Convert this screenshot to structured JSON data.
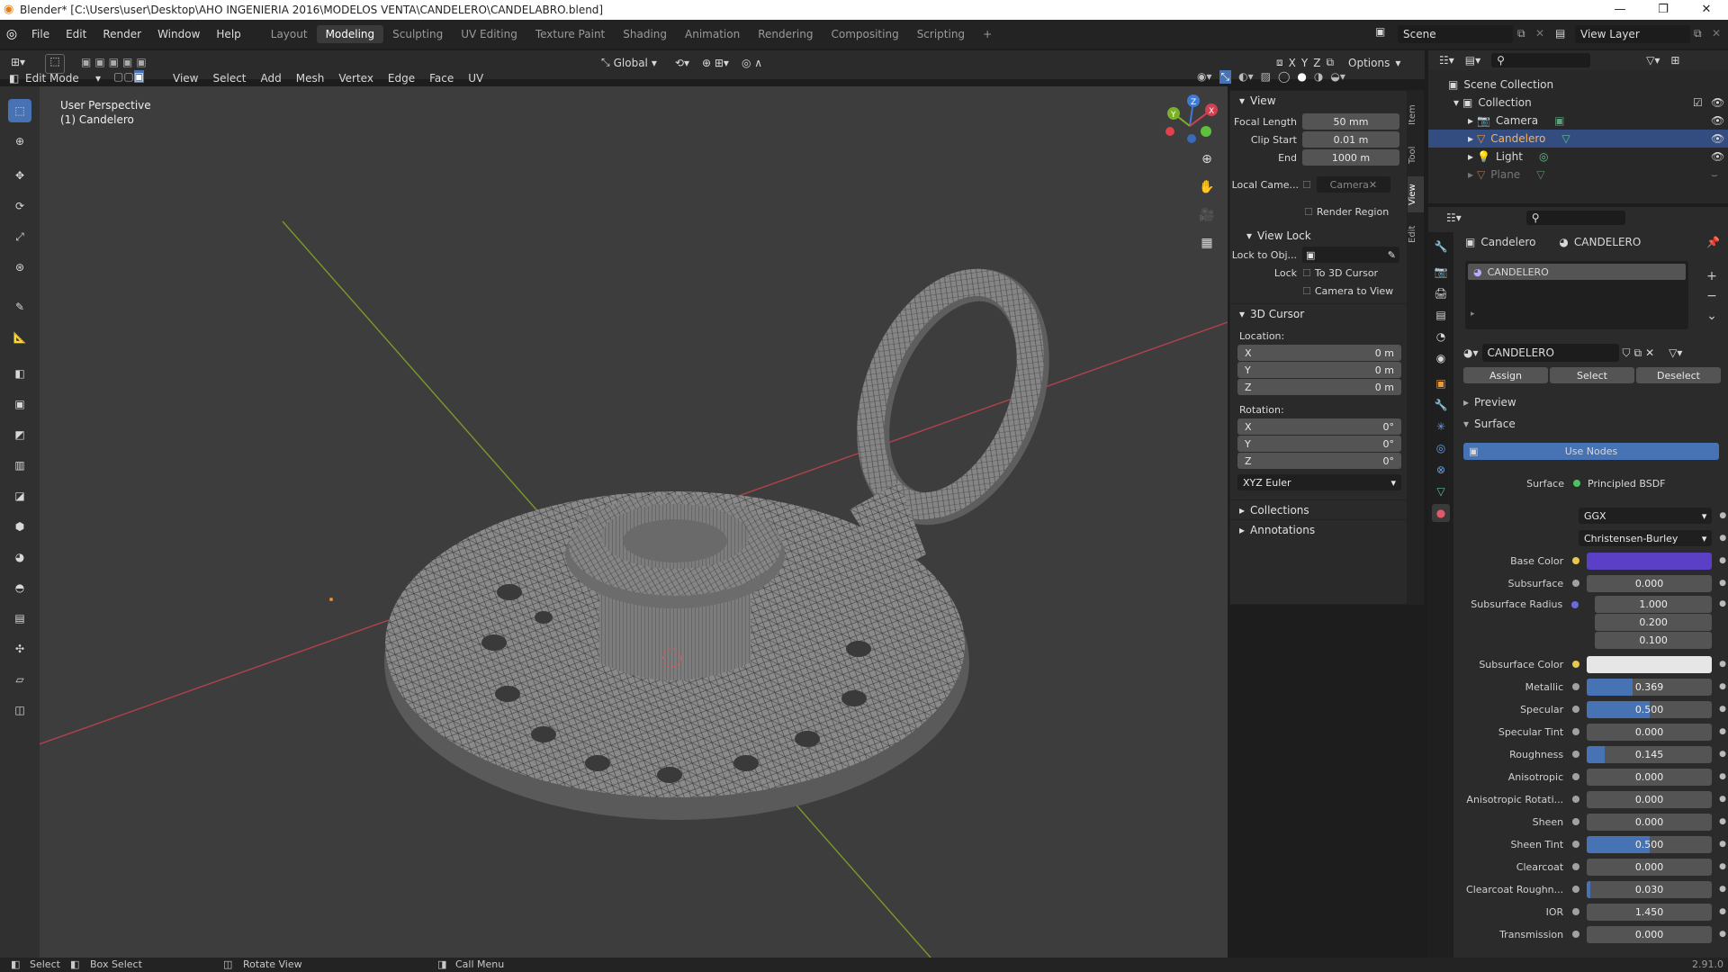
{
  "title": "Blender* [C:\\Users\\user\\Desktop\\AHO INGENIERIA 2016\\MODELOS VENTA\\CANDELERO\\CANDELABRO.blend]",
  "menus": [
    "File",
    "Edit",
    "Render",
    "Window",
    "Help"
  ],
  "workspaces": [
    "Layout",
    "Modeling",
    "Sculpting",
    "UV Editing",
    "Texture Paint",
    "Shading",
    "Animation",
    "Rendering",
    "Compositing",
    "Scripting"
  ],
  "active_workspace": "Modeling",
  "scene": "Scene",
  "view_layer": "View Layer",
  "header": {
    "mode": "Edit Mode",
    "menus": [
      "View",
      "Select",
      "Add",
      "Mesh",
      "Vertex",
      "Edge",
      "Face",
      "UV"
    ],
    "orientation": "Global",
    "axes": [
      "X",
      "Y",
      "Z"
    ],
    "options": "Options"
  },
  "viewport": {
    "perspective": "User Perspective",
    "object": "(1) Candelero",
    "gizmo": {
      "x": "X",
      "y": "Y",
      "z": "Z"
    }
  },
  "npanel": {
    "tabs": [
      "Item",
      "Tool",
      "View",
      "Edit"
    ],
    "view_title": "View",
    "focal_label": "Focal Length",
    "focal": "50 mm",
    "clip_start_label": "Clip Start",
    "clip_start": "0.01 m",
    "end_label": "End",
    "end": "1000 m",
    "local_camera_label": "Local Came...",
    "local_camera": "Camera",
    "render_region": "Render Region",
    "view_lock_title": "View Lock",
    "lock_obj_label": "Lock to Obj...",
    "lock_label": "Lock",
    "to_cursor": "To 3D Cursor",
    "cam_to_view": "Camera to View",
    "cursor_title": "3D Cursor",
    "location": "Location:",
    "loc": [
      {
        "a": "X",
        "v": "0 m"
      },
      {
        "a": "Y",
        "v": "0 m"
      },
      {
        "a": "Z",
        "v": "0 m"
      }
    ],
    "rotation": "Rotation:",
    "rot": [
      {
        "a": "X",
        "v": "0°"
      },
      {
        "a": "Y",
        "v": "0°"
      },
      {
        "a": "Z",
        "v": "0°"
      }
    ],
    "rot_mode": "XYZ Euler",
    "collections": "Collections",
    "annotations": "Annotations"
  },
  "outliner": {
    "root": "Scene Collection",
    "collection": "Collection",
    "items": [
      "Camera",
      "Candelero",
      "Light",
      "Plane"
    ]
  },
  "properties": {
    "breadcrumb_obj": "Candelero",
    "breadcrumb_mat": "CANDELERO",
    "slot": "CANDELERO",
    "material": "CANDELERO",
    "assign": "Assign",
    "select": "Select",
    "deselect": "Deselect",
    "preview": "Preview",
    "surface_title": "Surface",
    "use_nodes": "Use Nodes",
    "surface_label": "Surface",
    "surface_shader": "Principled BSDF",
    "distribution": "GGX",
    "subsurface_method": "Christensen-Burley",
    "base_color_label": "Base Color",
    "base_color": "#5b3fc4",
    "subsurface_color_label": "Subsurface Color",
    "subsurface_color": "#e6e6e6",
    "subsurface_radius_label": "Subsurface Radius",
    "subsurface_radius": [
      "1.000",
      "0.200",
      "0.100"
    ],
    "params": [
      {
        "label": "Subsurface",
        "value": "0.000",
        "fill": 0
      },
      {
        "label": "Metallic",
        "value": "0.369",
        "fill": 0.369
      },
      {
        "label": "Specular",
        "value": "0.500",
        "fill": 0.5
      },
      {
        "label": "Specular Tint",
        "value": "0.000",
        "fill": 0
      },
      {
        "label": "Roughness",
        "value": "0.145",
        "fill": 0.145
      },
      {
        "label": "Anisotropic",
        "value": "0.000",
        "fill": 0
      },
      {
        "label": "Anisotropic Rotati...",
        "value": "0.000",
        "fill": 0
      },
      {
        "label": "Sheen",
        "value": "0.000",
        "fill": 0
      },
      {
        "label": "Sheen Tint",
        "value": "0.500",
        "fill": 0.5
      },
      {
        "label": "Clearcoat",
        "value": "0.000",
        "fill": 0
      },
      {
        "label": "Clearcoat Roughn...",
        "value": "0.030",
        "fill": 0.03
      },
      {
        "label": "IOR",
        "value": "1.450",
        "fill": 0
      },
      {
        "label": "Transmission",
        "value": "0.000",
        "fill": 0
      }
    ]
  },
  "status": {
    "select": "Select",
    "box_select": "Box Select",
    "rotate": "Rotate View",
    "call_menu": "Call Menu",
    "version": "2.91.0"
  }
}
